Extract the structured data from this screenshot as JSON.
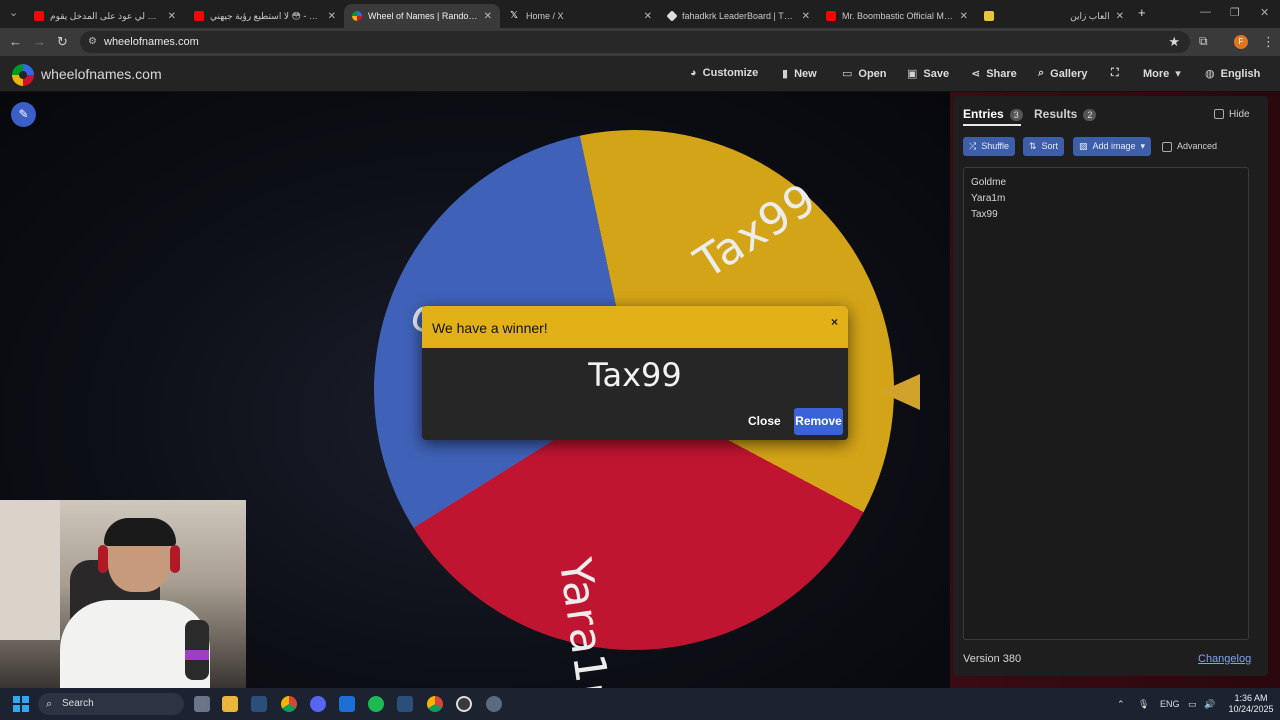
{
  "browser": {
    "tabs": [
      {
        "title": "حطيت لي عوذ على المدخل يقوم...",
        "favicon_color": "#ff0000",
        "active": false
      },
      {
        "title": "لا استطيع رؤية جيهني 😳 - YouTube",
        "favicon_color": "#ff0000",
        "active": false
      },
      {
        "title": "Wheel of Names | Random name picker",
        "favicon_color": "#4285f4",
        "active": true
      },
      {
        "title": "Home / X",
        "favicon_color": "#ffffff",
        "active": false
      },
      {
        "title": "fahadkrk LeaderBoard | The best",
        "favicon_color": "#dddddd",
        "active": false
      },
      {
        "title": "Mr. Boombastic Official Music Video",
        "favicon_color": "#ff0000",
        "active": false
      },
      {
        "title": "العاب زاين",
        "favicon_color": "#e8c53a",
        "active": false
      }
    ],
    "new_tab": "+",
    "url": "wheelofnames.com"
  },
  "site": {
    "name": "wheelofnames.com",
    "menu": {
      "customize": "Customize",
      "new": "New",
      "open": "Open",
      "save": "Save",
      "share": "Share",
      "gallery": "Gallery",
      "more": "More",
      "language": "English"
    }
  },
  "wheel": {
    "labels": {
      "tax": "Tax99",
      "yara": "Yara1m",
      "gold": "Go"
    },
    "colors": {
      "yellow": "#d4a418",
      "red": "#c01530",
      "blue": "#3f62b8"
    }
  },
  "dialog": {
    "title": "We have a winner!",
    "close_x": "×",
    "winner": "Tax99",
    "close": "Close",
    "remove": "Remove"
  },
  "panel": {
    "tab_entries": "Entries",
    "entries_count": "3",
    "tab_results": "Results",
    "results_count": "2",
    "hide": "Hide",
    "shuffle": "Shuffle",
    "sort": "Sort",
    "add_image": "Add image",
    "advanced": "Advanced",
    "entries": [
      "Goldme",
      "Yara1m",
      "Tax99"
    ],
    "version": "Version 380",
    "changelog": "Changelog"
  },
  "taskbar": {
    "search": "Search",
    "lang": "ENG",
    "time": "1:36 AM",
    "date": "10/24/2025"
  }
}
